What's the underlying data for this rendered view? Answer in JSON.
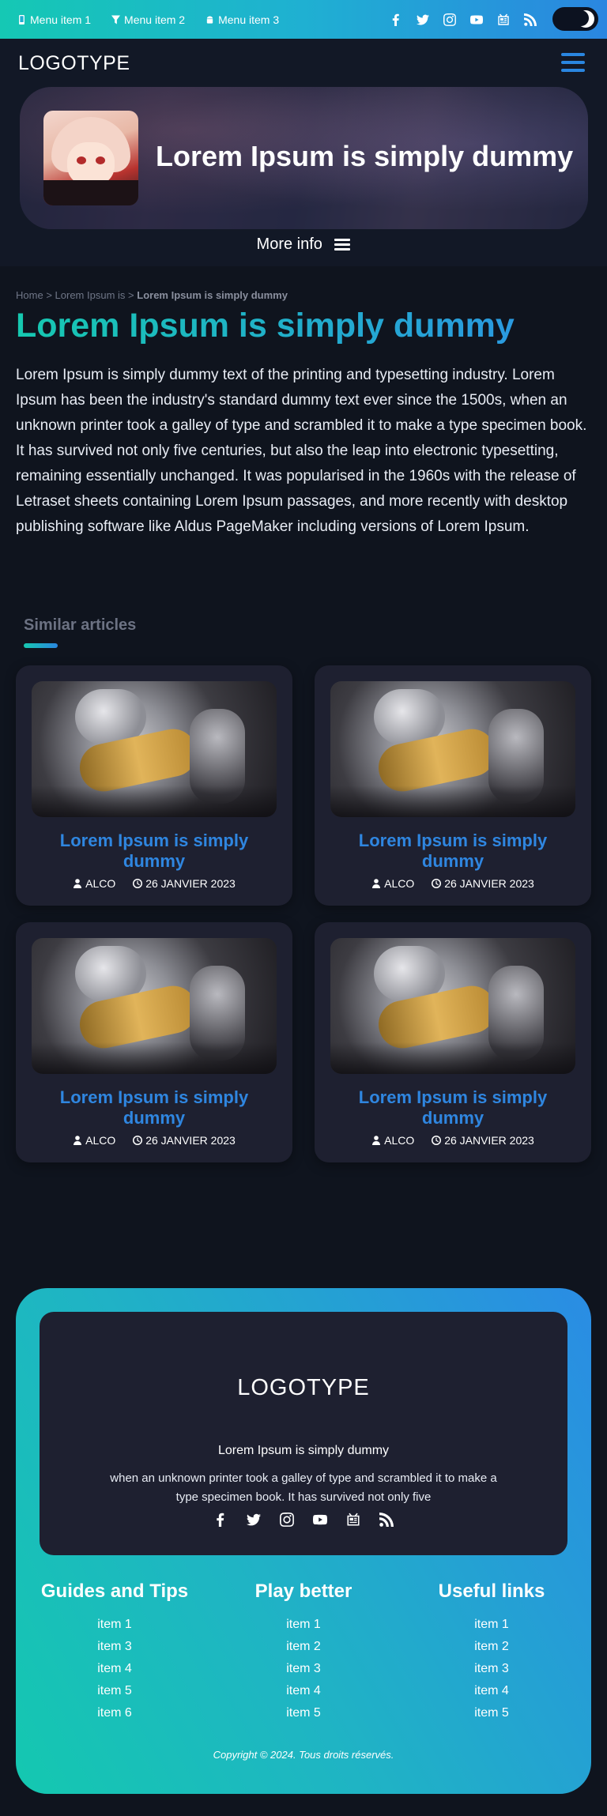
{
  "topbar": {
    "menu": [
      {
        "label": "Menu item 1",
        "icon": "mobile-icon"
      },
      {
        "label": "Menu item 2",
        "icon": "filter-icon"
      },
      {
        "label": "Menu item 3",
        "icon": "android-icon"
      }
    ],
    "socials": [
      "facebook-icon",
      "twitter-icon",
      "instagram-icon",
      "youtube-icon",
      "news-icon",
      "rss-icon"
    ]
  },
  "header": {
    "logo": "LOGOTYPE",
    "hero_title": "Lorem Ipsum is simply dummy",
    "more_info": "More info"
  },
  "article": {
    "breadcrumb": {
      "home": "Home",
      "sep": ">",
      "parent": "Lorem Ipsum is",
      "current": "Lorem Ipsum is simply dummy"
    },
    "title": "Lorem Ipsum is simply dummy",
    "intro": "Lorem Ipsum is simply dummy text of the printing and typesetting industry. Lorem Ipsum has been the industry's standard dummy text ever since the 1500s, when an unknown printer took a galley of type and scrambled it to make a type specimen book. It has survived not only five centuries, but also the leap into electronic typesetting, remaining essentially unchanged. It was popularised in the 1960s with the release of Letraset sheets containing Lorem Ipsum passages, and more recently with desktop publishing software like Aldus PageMaker including versions of Lorem Ipsum."
  },
  "similar": {
    "heading": "Similar articles",
    "cards": [
      {
        "title": "Lorem Ipsum is simply dummy",
        "author": "ALCO",
        "date": "26 JANVIER 2023"
      },
      {
        "title": "Lorem Ipsum is simply dummy",
        "author": "ALCO",
        "date": "26 JANVIER 2023"
      },
      {
        "title": "Lorem Ipsum is simply dummy",
        "author": "ALCO",
        "date": "26 JANVIER 2023"
      },
      {
        "title": "Lorem Ipsum is simply dummy",
        "author": "ALCO",
        "date": "26 JANVIER 2023"
      }
    ]
  },
  "footer": {
    "logo": "LOGOTYPE",
    "tagline": "Lorem Ipsum is simply dummy",
    "description": "when an unknown printer took a galley of type and scrambled it to make a type specimen book. It has survived not only five",
    "columns": [
      {
        "title": "Guides and Tips",
        "items": [
          "item 1",
          "item 3",
          "item 4",
          "item 5",
          "item 6"
        ]
      },
      {
        "title": "Play better",
        "items": [
          "item 1",
          "item 2",
          "item 3",
          "item 4",
          "item 5"
        ]
      },
      {
        "title": "Useful links",
        "items": [
          "item 1",
          "item 2",
          "item 3",
          "item 4",
          "item 5"
        ]
      }
    ],
    "copyright": "Copyright © 2024. Tous droits réservés."
  },
  "colors": {
    "accent_start": "#16c8b0",
    "accent_end": "#2a86e0",
    "page_bg": "#0f141e",
    "card_bg": "#1e2030",
    "link_blue": "#2f86e0"
  }
}
